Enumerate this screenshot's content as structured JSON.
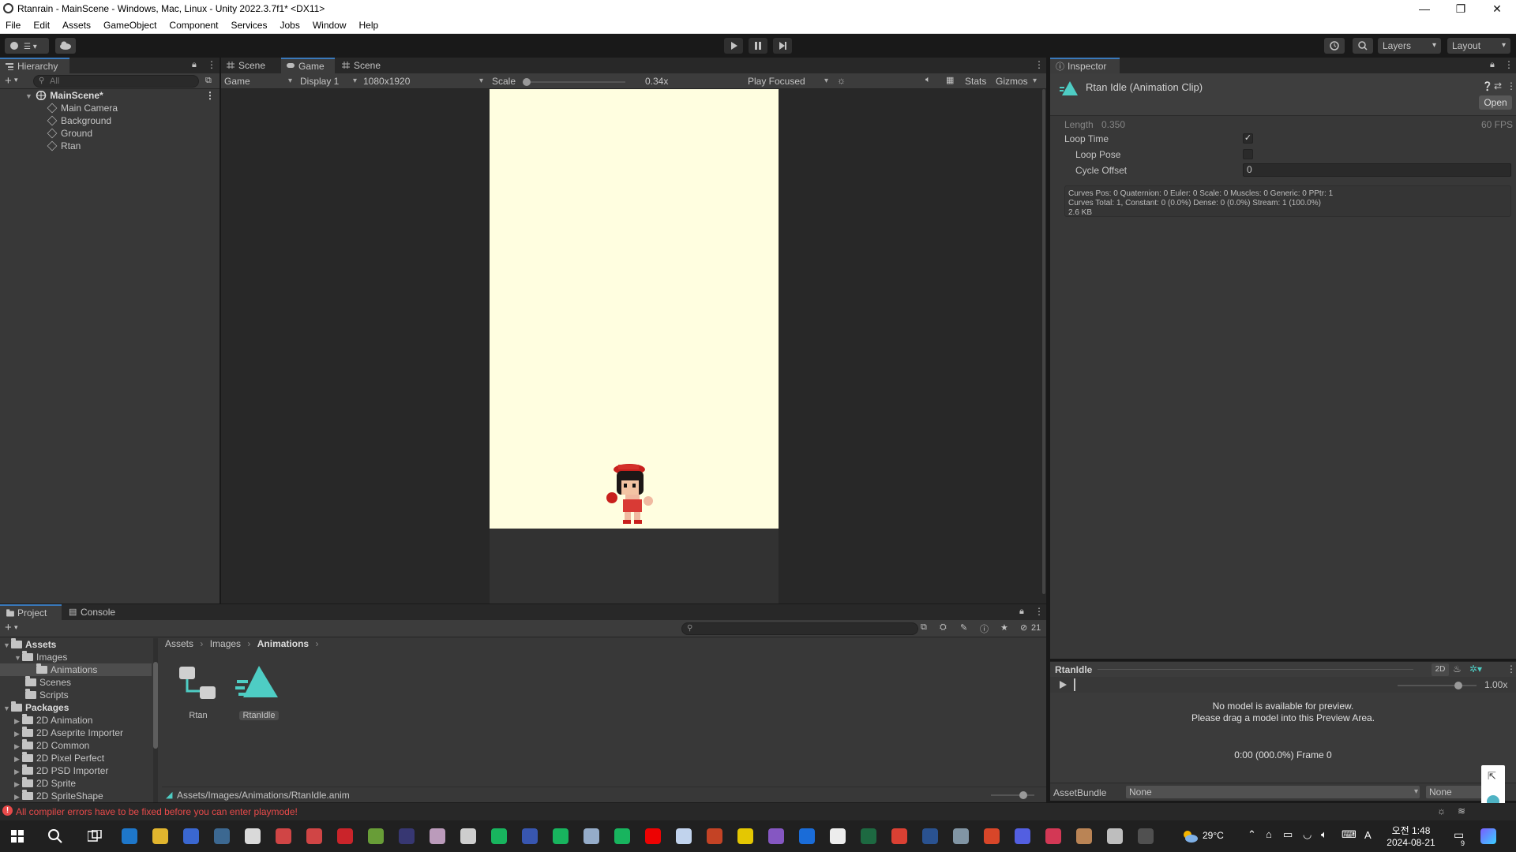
{
  "window": {
    "title": "Rtanrain - MainScene - Windows, Mac, Linux - Unity 2022.3.7f1* <DX11>",
    "controls": [
      "—",
      "❐",
      "✕"
    ]
  },
  "menu": [
    "File",
    "Edit",
    "Assets",
    "GameObject",
    "Component",
    "Services",
    "Jobs",
    "Window",
    "Help"
  ],
  "toolbar": {
    "layers": "Layers",
    "layout": "Layout"
  },
  "hierarchy": {
    "tab": "Hierarchy",
    "search_placeholder": "All",
    "scene": "MainScene*",
    "items": [
      "Main Camera",
      "Background",
      "Ground",
      "Rtan"
    ]
  },
  "center_tabs": [
    "Scene",
    "Game",
    "Scene"
  ],
  "game_toolbar": {
    "mode": "Game",
    "display": "Display 1",
    "resolution": "1080x1920",
    "scale_label": "Scale",
    "scale_value": 0.34,
    "scale_text": "0.34x",
    "play_focus": "Play Focused",
    "stats": "Stats",
    "gizmos": "Gizmos"
  },
  "inspector": {
    "tab": "Inspector",
    "asset_title": "Rtan Idle (Animation Clip)",
    "open": "Open",
    "length_label": "Length",
    "length_value": "0.350",
    "fps": "60 FPS",
    "loop_time": "Loop Time",
    "loop_pose": "Loop Pose",
    "cycle_offset": "Cycle Offset",
    "cycle_offset_value": "0",
    "curves_line1": "Curves Pos: 0 Quaternion: 0 Euler: 0 Scale: 0 Muscles: 0 Generic: 0 PPtr: 1",
    "curves_line2": "Curves Total: 1, Constant: 0 (0.0%) Dense: 0 (0.0%) Stream: 1 (100.0%)",
    "curves_line3": "2.6 KB",
    "loop_time_checked": true,
    "loop_pose_checked": false
  },
  "preview": {
    "name": "RtanIdle",
    "mode_2d": "2D",
    "speed": "1.00x",
    "speed_value": 1.0,
    "message1": "No model is available for preview.",
    "message2": "Please drag a model into this Preview Area.",
    "time": "0:00 (000.0%) Frame 0"
  },
  "assetbundle": {
    "label": "AssetBundle",
    "value": "None",
    "variant": "None"
  },
  "project": {
    "tabs": [
      "Project",
      "Console"
    ],
    "hidden_count": "21",
    "tree": {
      "assets": "Assets",
      "images": "Images",
      "animations": "Animations",
      "scenes": "Scenes",
      "scripts": "Scripts",
      "packages": "Packages",
      "packages_list": [
        "2D Animation",
        "2D Aseprite Importer",
        "2D Common",
        "2D Pixel Perfect",
        "2D PSD Importer",
        "2D Sprite",
        "2D SpriteShape"
      ]
    },
    "breadcrumb": [
      "Assets",
      "Images",
      "Animations"
    ],
    "files": [
      "Rtan",
      "RtanIdle"
    ],
    "path": "Assets/Images/Animations/RtanIdle.anim"
  },
  "status": {
    "error": "All compiler errors have to be fixed before you can enter playmode!"
  },
  "taskbar": {
    "temp": "29°C",
    "ime": "A",
    "time_period": "오전 1:48",
    "date": "2024-08-21",
    "notif_count": "9"
  },
  "colors": {
    "game_bg": "#fffee0",
    "accent_blue": "#3a79bb",
    "anim_clip": "#4ecdc4",
    "error_red": "#e84a4a"
  }
}
